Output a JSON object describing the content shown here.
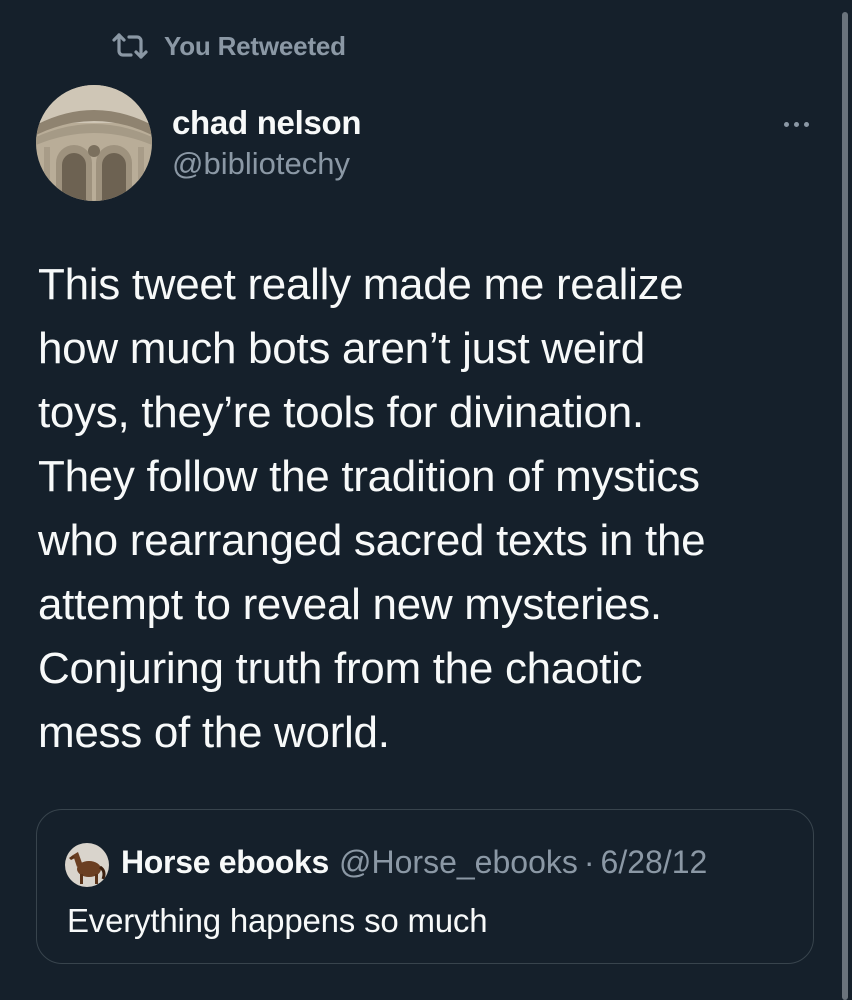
{
  "retweet_context": {
    "icon": "retweet-icon",
    "label": "You Retweeted"
  },
  "tweet": {
    "author_name": "chad nelson",
    "author_handle": "@bibliotechy",
    "more_icon": "more-horizontal-icon",
    "text_lines": [
      "This tweet really made me realize",
      "how much bots aren’t just weird",
      "toys, they’re tools for divination.",
      "They follow the tradition of mystics",
      "who rearranged sacred texts in the",
      "attempt to reveal new mysteries.",
      "Conjuring truth from the chaotic",
      "mess of the world."
    ]
  },
  "quoted_tweet": {
    "author_name": "Horse ebooks",
    "author_handle": "@Horse_ebooks",
    "separator": "·",
    "date": "6/28/12",
    "text": "Everything happens so much"
  },
  "colors": {
    "background": "#15202b",
    "primary_text": "#f7f9f9",
    "secondary_text": "#8b98a5",
    "border": "#38444d"
  }
}
